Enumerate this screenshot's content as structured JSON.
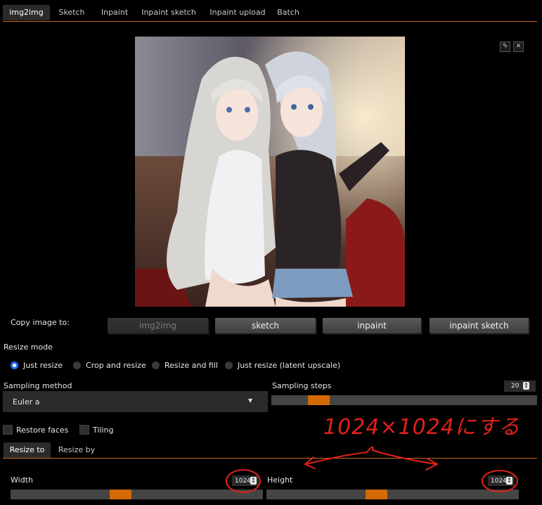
{
  "tabs": [
    {
      "label": "img2img",
      "active": true
    },
    {
      "label": "Sketch"
    },
    {
      "label": "Inpaint"
    },
    {
      "label": "Inpaint sketch"
    },
    {
      "label": "Inpaint upload"
    },
    {
      "label": "Batch"
    }
  ],
  "image_tools": {
    "edit_icon": "pencil-icon",
    "close_icon": "close-icon"
  },
  "copy": {
    "label": "Copy image to:",
    "buttons": [
      "img2img",
      "sketch",
      "inpaint",
      "inpaint sketch"
    ]
  },
  "resize_mode": {
    "label": "Resize mode",
    "options": [
      "Just resize",
      "Crop and resize",
      "Resize and fill",
      "Just resize (latent upscale)"
    ],
    "selected": "Just resize"
  },
  "sampling": {
    "method_label": "Sampling method",
    "method_value": "Euler a",
    "steps_label": "Sampling steps",
    "steps_value": "20",
    "steps_fraction": 0.15
  },
  "checks": {
    "restore_faces": "Restore faces",
    "tiling": "Tiling"
  },
  "resize_tabs": [
    "Resize to",
    "Resize by"
  ],
  "dims": {
    "width_label": "Width",
    "width_value": "1024",
    "height_label": "Height",
    "height_value": "1024",
    "fraction": 0.43
  },
  "annotation": {
    "text": "1024×1024にする"
  },
  "colors": {
    "accent": "#d36a06",
    "radio": "#1f6cf2",
    "annotation": "#e0211b"
  }
}
